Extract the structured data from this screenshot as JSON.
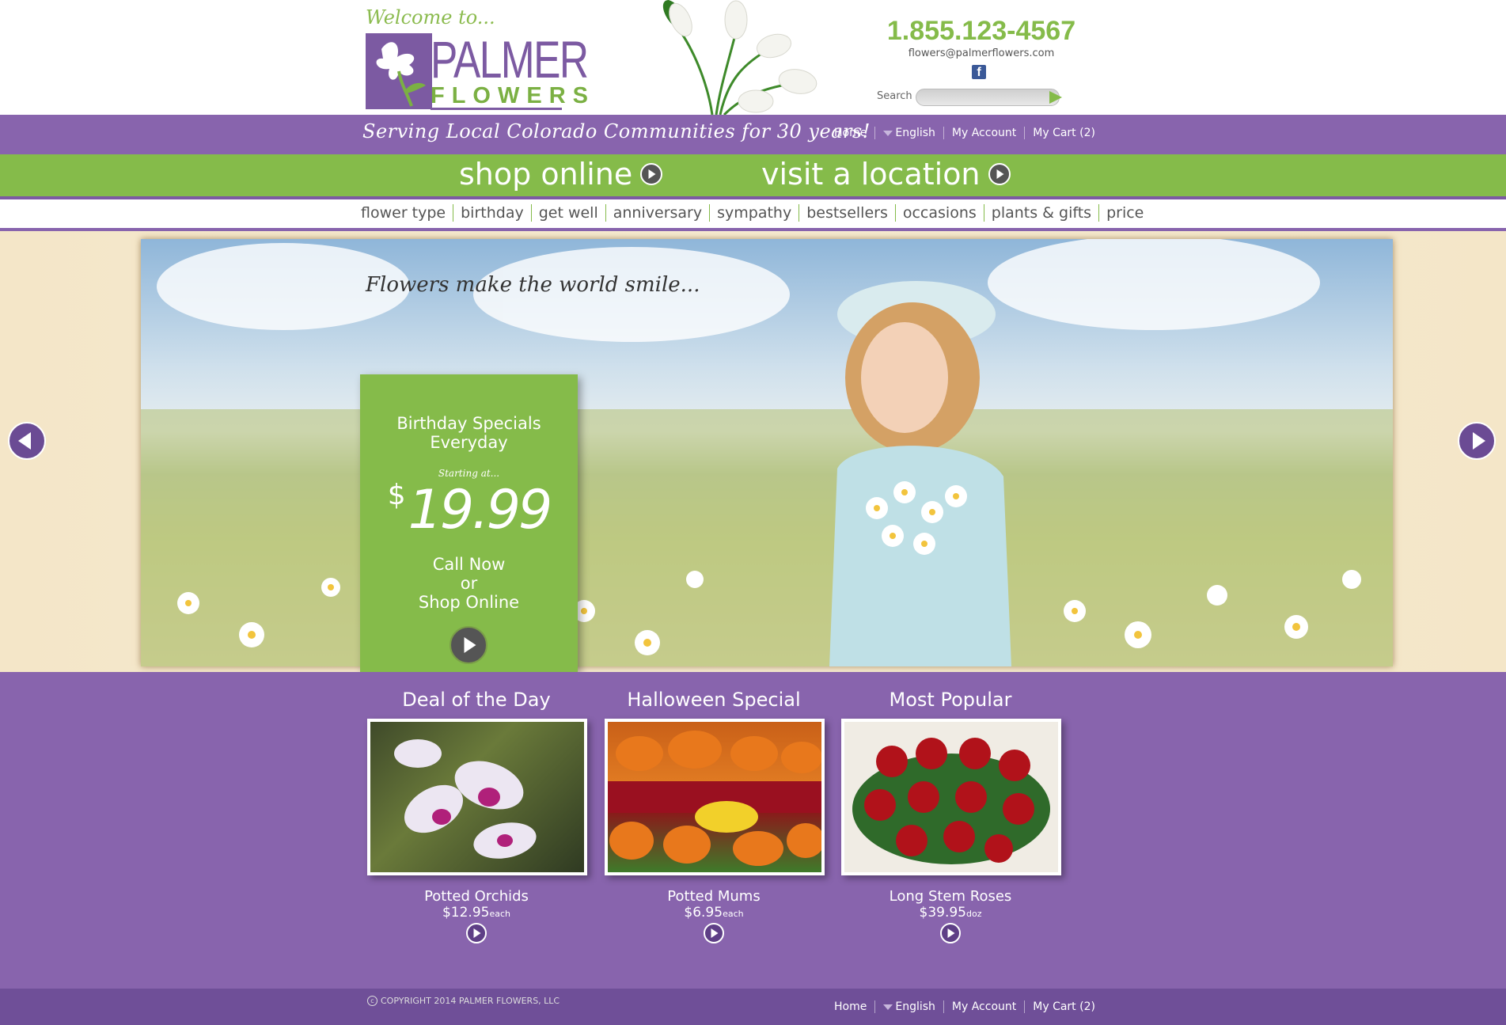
{
  "header": {
    "welcome": "Welcome to...",
    "brand_line1": "PALMER",
    "brand_line2": "FLOWERS",
    "phone": "1.855.123-4567",
    "email": "flowers@palmerflowers.com",
    "social_icon": "facebook-icon",
    "search_label": "Search",
    "search_placeholder": ""
  },
  "band": {
    "tagline": "Serving Local Colorado Communities for 30 years!"
  },
  "utility_nav": {
    "home": "Home",
    "language": "English",
    "account": "My Account",
    "cart": "My Cart (2)"
  },
  "main_nav": {
    "shop_online": "shop online",
    "visit_location": "visit a location"
  },
  "categories": [
    "flower type",
    "birthday",
    "get well",
    "anniversary",
    "sympathy",
    "bestsellers",
    "occasions",
    "plants & gifts",
    "price"
  ],
  "hero": {
    "title": "Flowers make the world smile...",
    "promo_title": "Birthday Specials\nEveryday",
    "promo_start": "Starting at...",
    "promo_currency": "$",
    "promo_price": "19.99",
    "promo_cta": "Call Now\nor\nShop Online"
  },
  "products": [
    {
      "heading": "Deal of the Day",
      "name": "Potted Orchids",
      "price": "$12.95",
      "unit": "each"
    },
    {
      "heading": "Halloween Special",
      "name": "Potted Mums",
      "price": "$6.95",
      "unit": "each"
    },
    {
      "heading": "Most Popular",
      "name": "Long Stem Roses",
      "price": "$39.95",
      "unit": "doz"
    }
  ],
  "footer": {
    "copyright": "COPYRIGHT 2014 PALMER FLOWERS, LLC"
  },
  "colors": {
    "purple": "#8864ad",
    "green": "#85bb4a",
    "dark_purple": "#6f4f98"
  }
}
